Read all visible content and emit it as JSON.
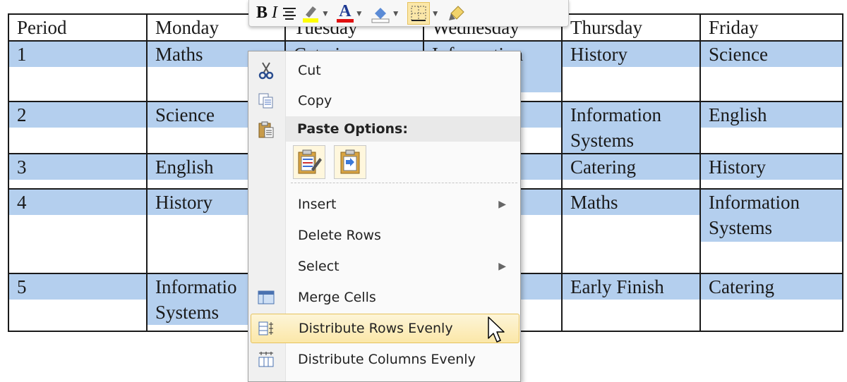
{
  "table": {
    "headers": [
      "Period",
      "Monday",
      "Tuesday",
      "Wednesday",
      "Thursday",
      "Friday"
    ],
    "rows": [
      [
        "1",
        "Maths",
        "Catering",
        "Information Systems",
        "History",
        "Science"
      ],
      [
        "2",
        "Science",
        "",
        "",
        "Information\nSystems",
        "English"
      ],
      [
        "3",
        "English",
        "",
        "",
        "Catering",
        "History"
      ],
      [
        "4",
        "History",
        "",
        "",
        "Maths",
        "Information\nSystems"
      ],
      [
        "5",
        "Informatio\nSystems",
        "",
        "",
        "Early Finish",
        "Catering"
      ]
    ]
  },
  "mini_toolbar": {
    "bold": "B",
    "italic": "I",
    "font_color_letter": "A",
    "icons": [
      "bold-icon",
      "italic-icon",
      "center-align-icon",
      "highlight-icon",
      "font-color-icon",
      "shading-icon",
      "borders-icon",
      "format-painter-icon"
    ],
    "colors": {
      "highlight": "#ffff00",
      "font_color": "#e01010"
    }
  },
  "context_menu": {
    "cut": "Cut",
    "copy": "Copy",
    "paste_options": "Paste Options:",
    "insert": "Insert",
    "delete_rows": "Delete Rows",
    "select": "Select",
    "merge_cells": "Merge Cells",
    "distribute_rows": "Distribute Rows Evenly",
    "distribute_columns": "Distribute Columns Evenly",
    "submenu_arrow": "▶"
  },
  "colors": {
    "selection": "#b4cfee",
    "hover": "#fbe7a8"
  }
}
